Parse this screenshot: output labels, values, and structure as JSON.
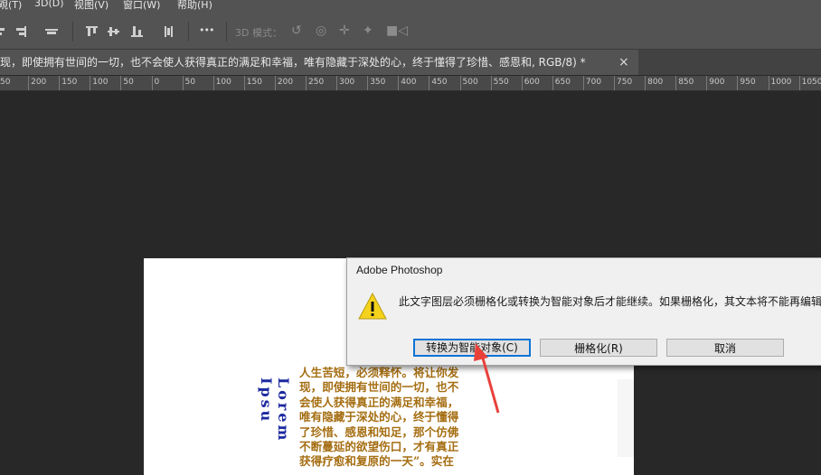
{
  "menubar": {
    "items": [
      "覌(T)",
      "3D(D)",
      "视图(V)",
      "窗口(W)",
      "帮助(H)"
    ]
  },
  "options_bar": {
    "label_3d": "3D 模式：",
    "more": "•••"
  },
  "document_tab": {
    "title": "现，即使拥有世间的一切，也不会使人获得真正的满足和幸福，唯有隐藏于深处的心，终于懂得了珍惜、感恩和, RGB/8) *",
    "close": "×"
  },
  "ruler": {
    "labels": [
      "50",
      "200",
      "150",
      "100",
      "50",
      "0",
      "50",
      "100",
      "150",
      "200",
      "250",
      "300",
      "350",
      "400",
      "450",
      "500",
      "550",
      "600",
      "650",
      "700",
      "750",
      "800",
      "850",
      "900",
      "950",
      "1000",
      "1050"
    ]
  },
  "canvas": {
    "vertical_title": "Lorem Ipsu",
    "body_lines": [
      "人生苦短，必须释怀。将让你发",
      "现，即使拥有世间的一切，也不",
      "会使人获得真正的满足和幸福，",
      "唯有隐藏于深处的心，终于懂得",
      "了珍惜、感恩和知足，那个仿佛",
      "不断蔓延的欲望伤口，才有真正",
      "获得疗愈和复原的一天”。实在"
    ]
  },
  "dialog": {
    "title": "Adobe Photoshop",
    "message": "此文字图层必须栅格化或转换为智能对象后才能继续。如果栅格化，其文本将不能再编辑",
    "buttons": {
      "convert": "转换为智能对象(C)",
      "rasterize": "栅格化(R)",
      "cancel": "取消"
    }
  },
  "colors": {
    "annotation_arrow": "#e8413a",
    "vertical_title": "#1c2aa0",
    "body_text": "#a56e12"
  }
}
